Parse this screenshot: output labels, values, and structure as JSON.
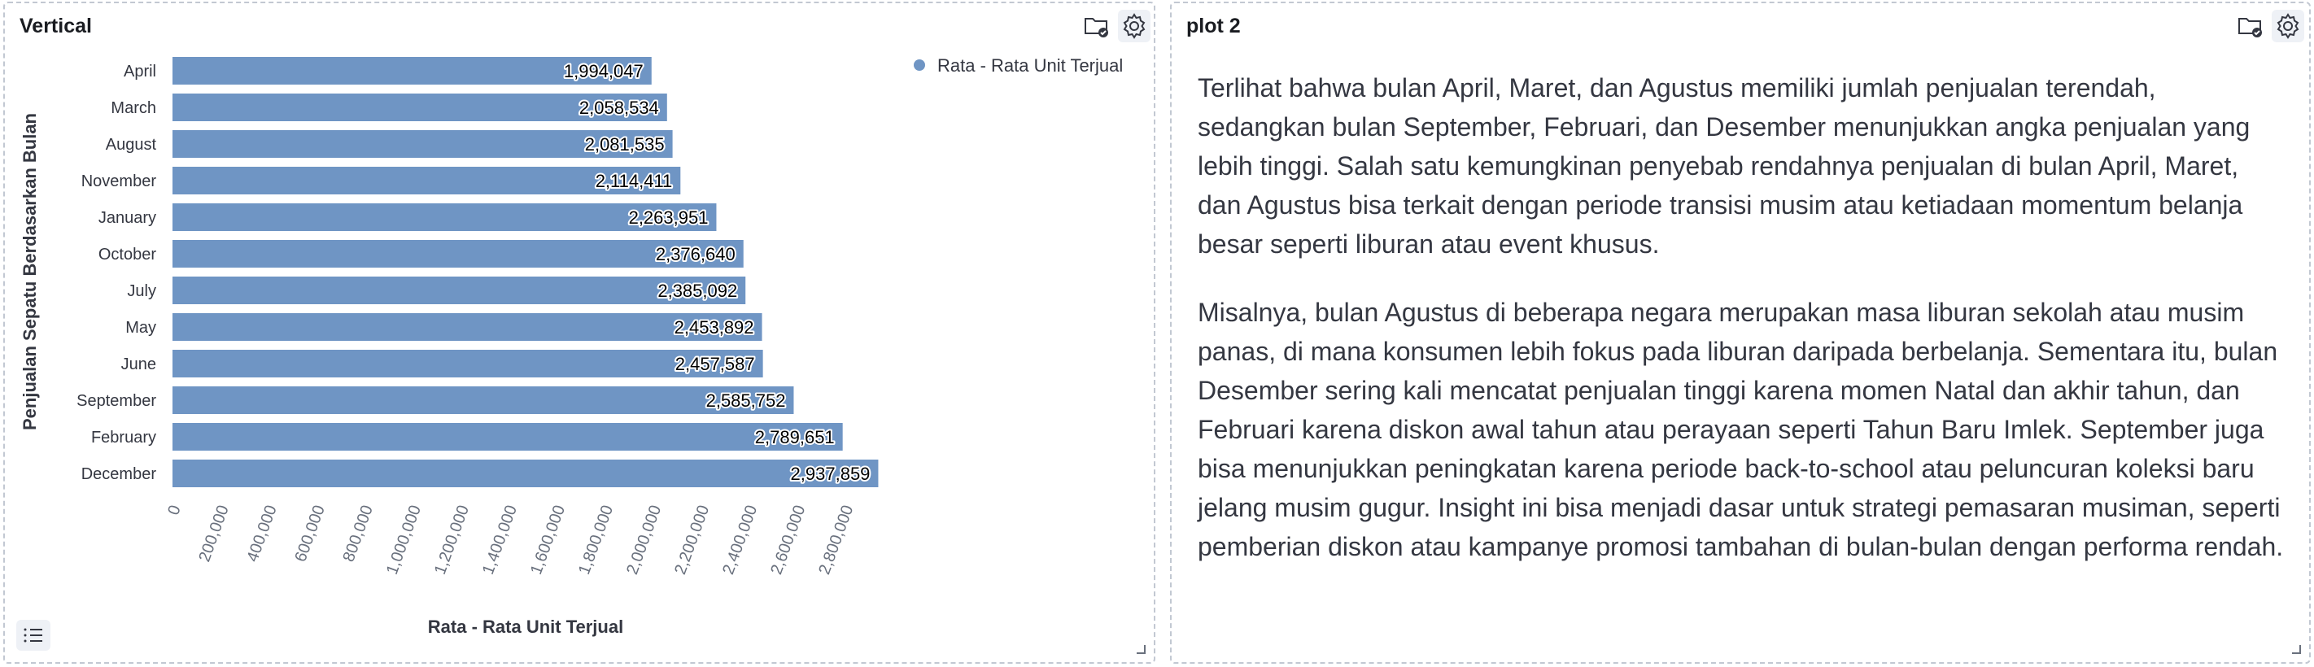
{
  "panels": {
    "left": {
      "title": "Vertical"
    },
    "right": {
      "title": "plot 2"
    }
  },
  "icons": {
    "inspect": "folder-check-icon",
    "settings": "gear-icon",
    "resize": "resize-corner-icon",
    "legend_toggle": "list-icon"
  },
  "colors": {
    "bar": "#6f95c4",
    "legend_dot": "#6f95c4",
    "text": "#343741"
  },
  "chart_data": {
    "type": "bar",
    "orientation": "horizontal",
    "categories": [
      "April",
      "March",
      "August",
      "November",
      "January",
      "October",
      "July",
      "May",
      "June",
      "September",
      "February",
      "December"
    ],
    "values": [
      1994047,
      2058534,
      2081535,
      2114411,
      2263951,
      2376640,
      2385092,
      2453892,
      2457587,
      2585752,
      2789651,
      2937859
    ],
    "value_labels": [
      "1,994,047",
      "2,058,534",
      "2,081,535",
      "2,114,411",
      "2,263,951",
      "2,376,640",
      "2,385,092",
      "2,453,892",
      "2,457,587",
      "2,585,752",
      "2,789,651",
      "2,937,859"
    ],
    "series": [
      {
        "name": "Rata - Rata Unit Terjual",
        "values": [
          1994047,
          2058534,
          2081535,
          2114411,
          2263951,
          2376640,
          2385092,
          2453892,
          2457587,
          2585752,
          2789651,
          2937859
        ]
      }
    ],
    "xlabel": "Rata - Rata Unit Terjual",
    "ylabel": "Penjualan Sepatu Berdasarkan Bulan",
    "xlim": [
      0,
      2937859
    ],
    "x_ticks": [
      "0",
      "200,000",
      "400,000",
      "600,000",
      "800,000",
      "1,000,000",
      "1,200,000",
      "1,400,000",
      "1,600,000",
      "1,800,000",
      "2,000,000",
      "2,200,000",
      "2,400,000",
      "2,600,000",
      "2,800,000"
    ],
    "x_tick_values": [
      0,
      200000,
      400000,
      600000,
      800000,
      1000000,
      1200000,
      1400000,
      1600000,
      1800000,
      2000000,
      2200000,
      2400000,
      2600000,
      2800000
    ],
    "grid": false,
    "legend_position": "top-right"
  },
  "text_panel": {
    "paragraphs": [
      "Terlihat bahwa bulan April, Maret, dan Agustus memiliki jumlah penjualan terendah, sedangkan bulan September, Februari, dan Desember menunjukkan angka penjualan yang lebih tinggi. Salah satu kemungkinan penyebab rendahnya penjualan di bulan April, Maret, dan Agustus bisa terkait dengan periode transisi musim atau ketiadaan momentum belanja besar seperti liburan atau event khusus.",
      "Misalnya, bulan Agustus di beberapa negara merupakan masa liburan sekolah atau musim panas, di mana konsumen lebih fokus pada liburan daripada berbelanja. Sementara itu, bulan Desember sering kali mencatat penjualan tinggi karena momen Natal dan akhir tahun, dan Februari karena diskon awal tahun atau perayaan seperti Tahun Baru Imlek. September juga bisa menunjukkan peningkatan karena periode back-to-school atau peluncuran koleksi baru jelang musim gugur. Insight ini bisa menjadi dasar untuk strategi pemasaran musiman, seperti pemberian diskon atau kampanye promosi tambahan di bulan-bulan dengan performa rendah."
    ]
  }
}
